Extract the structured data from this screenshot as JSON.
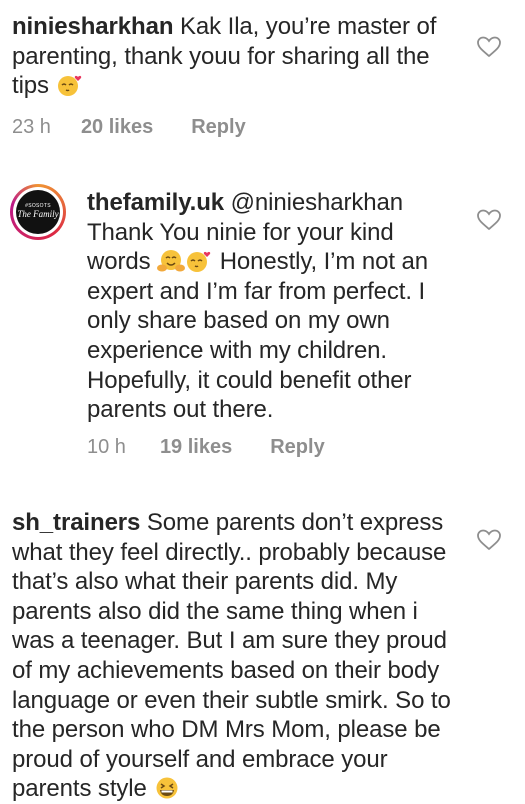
{
  "comments": [
    {
      "username": "niniesharkhan",
      "text": "Kak Ila, you’re master of parenting, thank youu for sharing all the tips",
      "time": "23 h",
      "likes": "20 likes",
      "reply": "Reply",
      "trailing_emoji": "smiling-face-blowing-kiss-emoji"
    },
    {
      "username": "thefamily.uk",
      "mention": "@niniesharkhan",
      "text_before_emoji": "Thank You ninie for your kind words",
      "text_after_emoji": "Honestly, I’m not an expert and I’m far from perfect. I only share based on my own experience with my children. Hopefully, it could benefit other parents out there.",
      "time": "10 h",
      "likes": "19 likes",
      "reply": "Reply",
      "avatar_badge": "#SOSOTS",
      "avatar_name": "The Family",
      "emojis": [
        "hugging-face-emoji",
        "smiling-face-blowing-kiss-emoji"
      ]
    },
    {
      "username": "sh_trainers",
      "text": "Some parents don’t express what they feel directly.. probably because that’s also what their parents did. My parents also did the same thing when i was a teenager. But I am sure they proud of my achievements based on their body language or even their subtle smirk. So to the person who DM Mrs Mom, please be proud of yourself and embrace your parents style",
      "trailing_emoji": "grinning-squinting-face-emoji"
    }
  ],
  "icons": {
    "heart": "heart-outline-icon"
  },
  "colors": {
    "text": "#262626",
    "meta": "#8e8e8e",
    "emoji": "#f7c23a"
  }
}
